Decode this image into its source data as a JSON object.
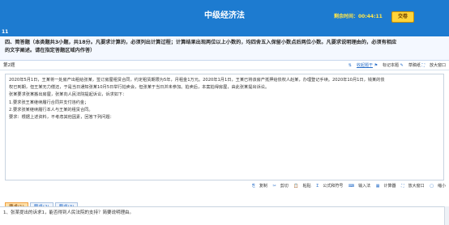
{
  "header": {
    "title": "中级经济法",
    "timer": "剩余时间：00:44:11",
    "submit_label": "交卷"
  },
  "question_number": "11",
  "section": {
    "instruction_line1": "四、简答题（本类题共3小题，共18分。凡要求计算的，必须列出计算过程；计算结果出现两位以上小数的，均四舍五入保留小数点后两位小数。凡要求说明理由的，必须有相应",
    "instruction_line2": "的文字阐述。请在指定答题区域内作答）"
  },
  "toolbar": {
    "question_label": "第2题",
    "collect_label": "收起题干",
    "mark_label": "标记本题",
    "draft_label": "草稿纸",
    "enlarge_label": "放大窗口"
  },
  "case": {
    "paragraphs": [
      "2020年5月1日，王某将一处房产出租给张某，签订房屋租赁合同，约定租赁期限为5年，月租金1万元。2020年1月1日，王某已将该房产抵押给债权人赵某，办理登记手续。2020年10月1日，钱某的债",
      "权已到期，但王某无力偿还，于是当日通知张某10月5日举行拍卖会，但张某于当日并未参加。拍卖后，本案拍得房屋，由此张某提出诉讼。",
      "张某要求张某搬出房屋，张某向人民法院提起诉讼，诉求如下：",
      "1.要求张王某继续履行合同并支付违约金；",
      "2.要求张某继续履行本人与王某的租赁合同。",
      "要求：根据上述资料，不考虑其他因素，回答下列问题："
    ]
  },
  "case_tools": {
    "copy_label": "复制",
    "cut_label": "剪切",
    "paste_label": "粘贴",
    "formula_label": "公式和符号",
    "input_label": "输入法",
    "calc_label": "计算器",
    "enlarge_label": "放大窗口",
    "shrink_label": "缩小"
  },
  "tabs": [
    "要求(1)",
    "要求(2)",
    "要求(3)"
  ],
  "requirement": {
    "text": "1、张某提出的诉求1，能否得到人民法院的支持？简要说明理由。"
  },
  "colors": {
    "header_bg": "#1d7bd0",
    "timer": "#ffe64a",
    "submit_bg": "#ffd43a",
    "active_tab_bg": "#ffe0a8"
  }
}
